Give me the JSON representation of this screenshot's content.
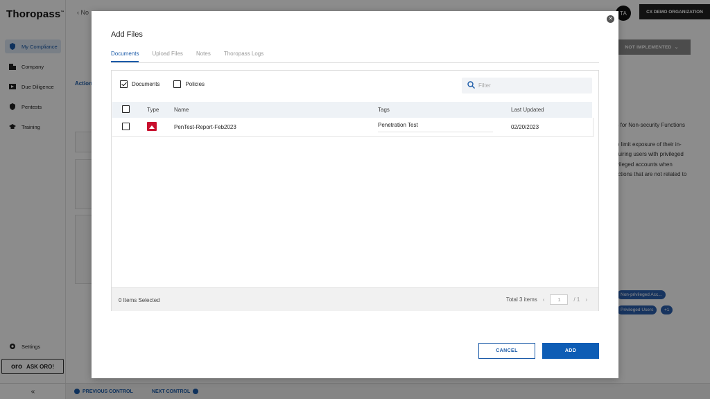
{
  "app": {
    "logo": "Thoropass",
    "logo_tm": "™",
    "breadcrumb": "‹ No",
    "org_name": "CX DEMO ORGANIZATION",
    "avatar_initials": "TA",
    "status_button": "NOT IMPLEMENTED",
    "actions_tab": "Action",
    "right_panel_lines": [
      "ess for Non-security Functions",
      "d to limit exposure of their in-",
      "requiring users with privileged",
      "privileged accounts when",
      "functions that are not related to"
    ],
    "right_tags": [
      "Non-privileged Acc...",
      "Privileged Users",
      "+1"
    ],
    "sidebar": {
      "items": [
        {
          "label": "My Compliance",
          "icon": "shield-icon",
          "active": true
        },
        {
          "label": "Company",
          "icon": "building-icon",
          "active": false
        },
        {
          "label": "Due Diligence",
          "icon": "folder-icon",
          "active": false
        },
        {
          "label": "Pentests",
          "icon": "shield-check-icon",
          "active": false
        },
        {
          "label": "Training",
          "icon": "graduation-cap-icon",
          "active": false
        }
      ],
      "settings": "Settings",
      "ask_oro": "ASK ORO!",
      "oro_logo": "oro",
      "collapse": "«"
    },
    "bottom_nav": {
      "previous": "PREVIOUS CONTROL",
      "next": "NEXT CONTROL"
    }
  },
  "modal": {
    "title": "Add Files",
    "tabs": [
      {
        "label": "Documents",
        "active": true
      },
      {
        "label": "Upload Files",
        "active": false
      },
      {
        "label": "Notes",
        "active": false
      },
      {
        "label": "Thoropass Logs",
        "active": false
      }
    ],
    "filters": {
      "documents": {
        "label": "Documents",
        "checked": true
      },
      "policies": {
        "label": "Policies",
        "checked": false
      }
    },
    "search": {
      "placeholder": "Filter",
      "value": ""
    },
    "table": {
      "columns": [
        "Type",
        "Name",
        "Tags",
        "Last Updated"
      ],
      "rows": [
        {
          "type_icon": "image-file-icon",
          "name": "PenTest-Report-Feb2023",
          "tags": "Penetration Test",
          "last_updated": "02/20/2023",
          "selected": false
        }
      ]
    },
    "footer": {
      "selected_text": "0 Items Selected",
      "total_text": "Total 3 items",
      "page_current": "1",
      "page_total": "/ 1"
    },
    "buttons": {
      "cancel": "CANCEL",
      "add": "ADD"
    },
    "accent_color": "#1a5aa8",
    "file_icon_color": "#c8102e"
  }
}
